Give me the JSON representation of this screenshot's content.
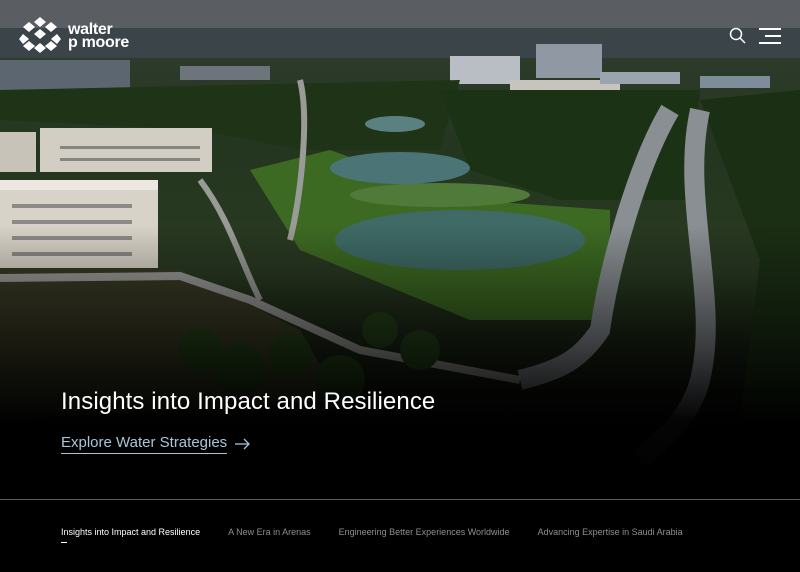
{
  "brand": {
    "line1": "walter",
    "line2": "p moore"
  },
  "header": {
    "search_icon": "search-icon",
    "menu_icon": "hamburger-menu-icon"
  },
  "hero": {
    "headline": "Insights into Impact and Resilience",
    "cta_label": "Explore Water Strategies",
    "cta_icon": "arrow-right-icon",
    "cta_color": "#aac4d9"
  },
  "tabs": [
    {
      "label": "Insights into Impact and Resilience",
      "active": true
    },
    {
      "label": "A New Era in Arenas",
      "active": false
    },
    {
      "label": "Engineering Better Experiences Worldwide",
      "active": false
    },
    {
      "label": "Advancing Expertise in Saudi Arabia",
      "active": false
    }
  ]
}
